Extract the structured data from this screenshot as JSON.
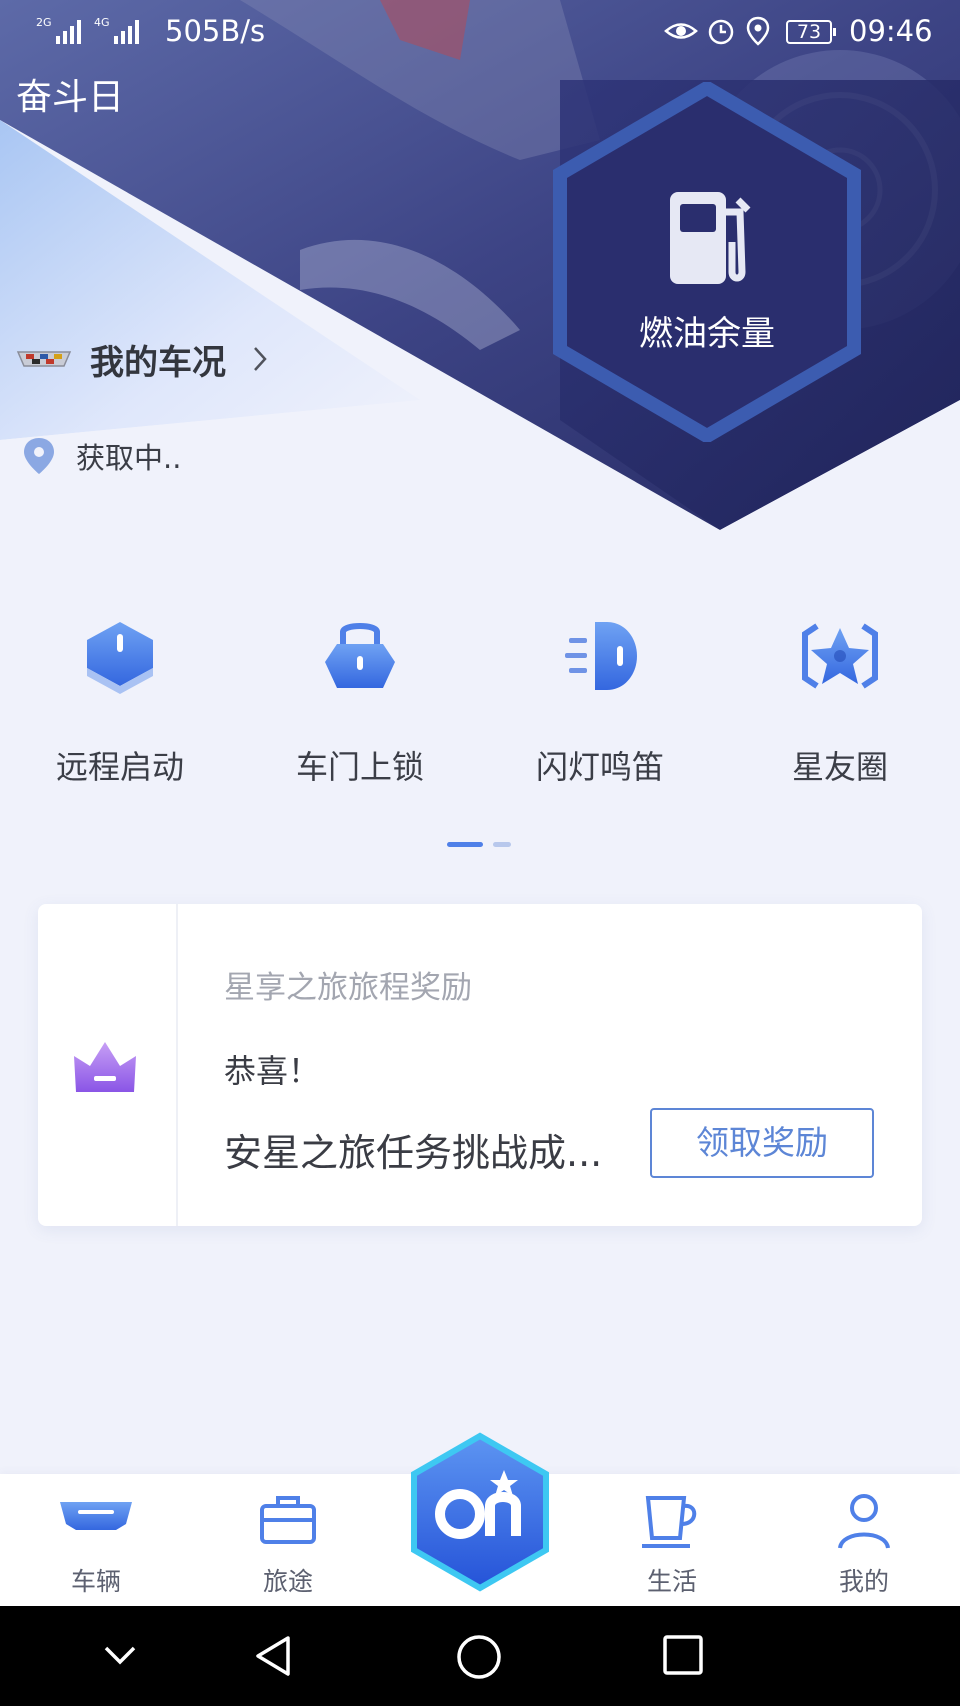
{
  "status_bar": {
    "net_left": "2G",
    "net_right": "4G",
    "speed": "505B/s",
    "battery": "73",
    "time": "09:46"
  },
  "header": {
    "day_label": "奋斗日"
  },
  "fuel": {
    "label": "燃油余量",
    "icon": "fuel-pump-icon"
  },
  "car_status": {
    "label": "我的车况",
    "icon": "cadillac-logo"
  },
  "location": {
    "text": "获取中.."
  },
  "actions": [
    {
      "label": "远程启动",
      "icon": "remote-start-icon"
    },
    {
      "label": "车门上锁",
      "icon": "door-lock-icon"
    },
    {
      "label": "闪灯鸣笛",
      "icon": "flash-horn-icon"
    },
    {
      "label": "星友圈",
      "icon": "star-circle-icon"
    }
  ],
  "reward_card": {
    "title": "星享之旅旅程奖励",
    "greeting": "恭喜！",
    "message": "安星之旅任务挑战成...",
    "button": "领取奖励",
    "icon": "crown-icon"
  },
  "tabs": [
    {
      "label": "车辆",
      "icon": "car-icon"
    },
    {
      "label": "旅途",
      "icon": "briefcase-icon"
    },
    {
      "label": "",
      "icon": "onstar-icon"
    },
    {
      "label": "生活",
      "icon": "cup-icon"
    },
    {
      "label": "我的",
      "icon": "person-icon"
    }
  ],
  "colors": {
    "accent": "#4f80e8",
    "hero_dark": "#2c2f6b",
    "badge": "#f25c5c"
  }
}
